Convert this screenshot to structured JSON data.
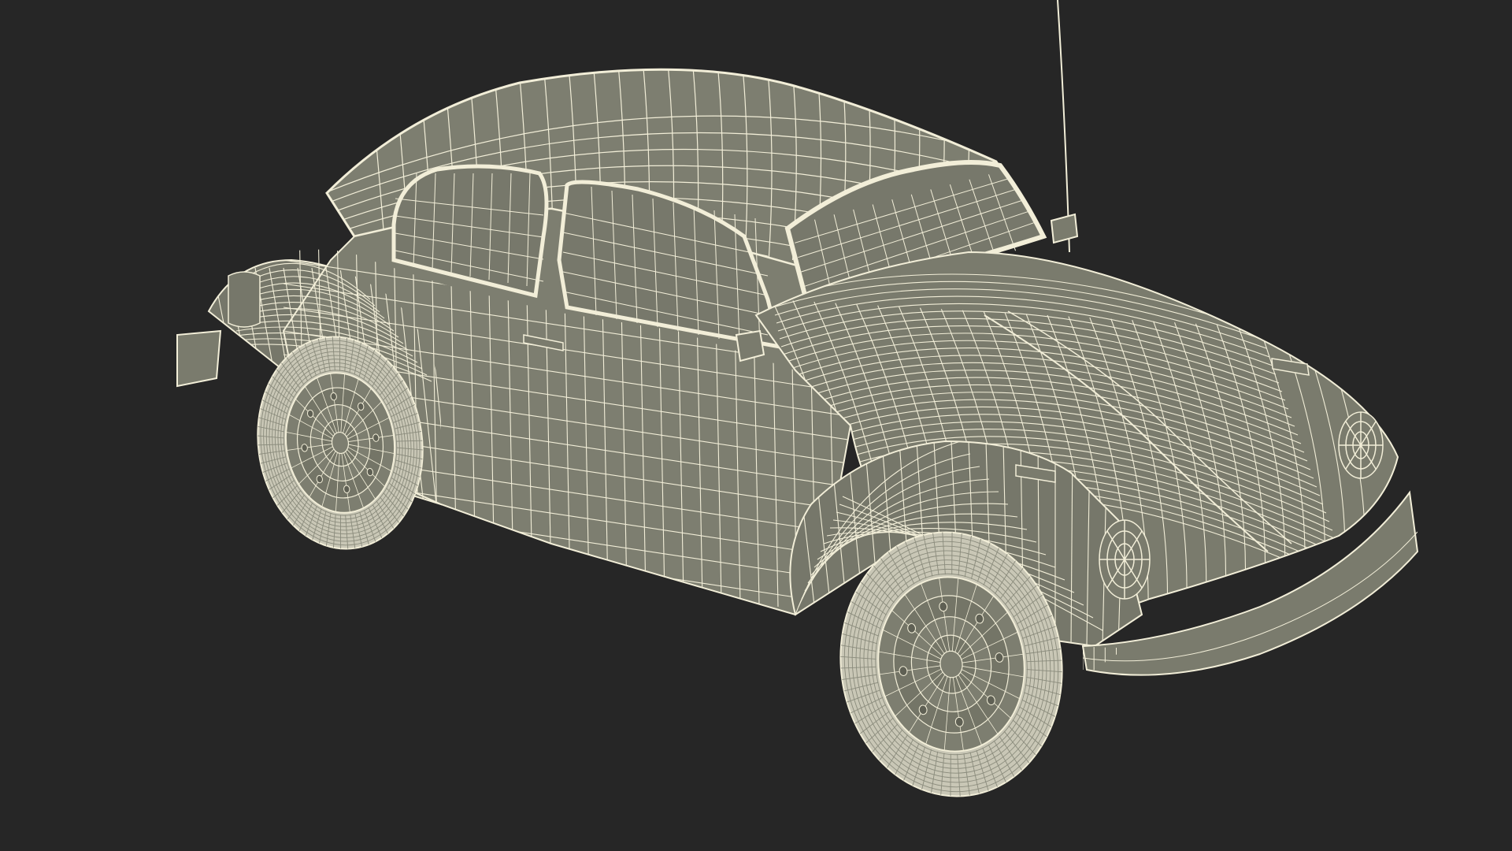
{
  "scene": {
    "background_color": "#262626",
    "model_fill_color": "#7d7e70",
    "model_shade_color": "#6c6d60",
    "wire_color": "#f2eed8",
    "tire_color": "#c9c7b6"
  }
}
